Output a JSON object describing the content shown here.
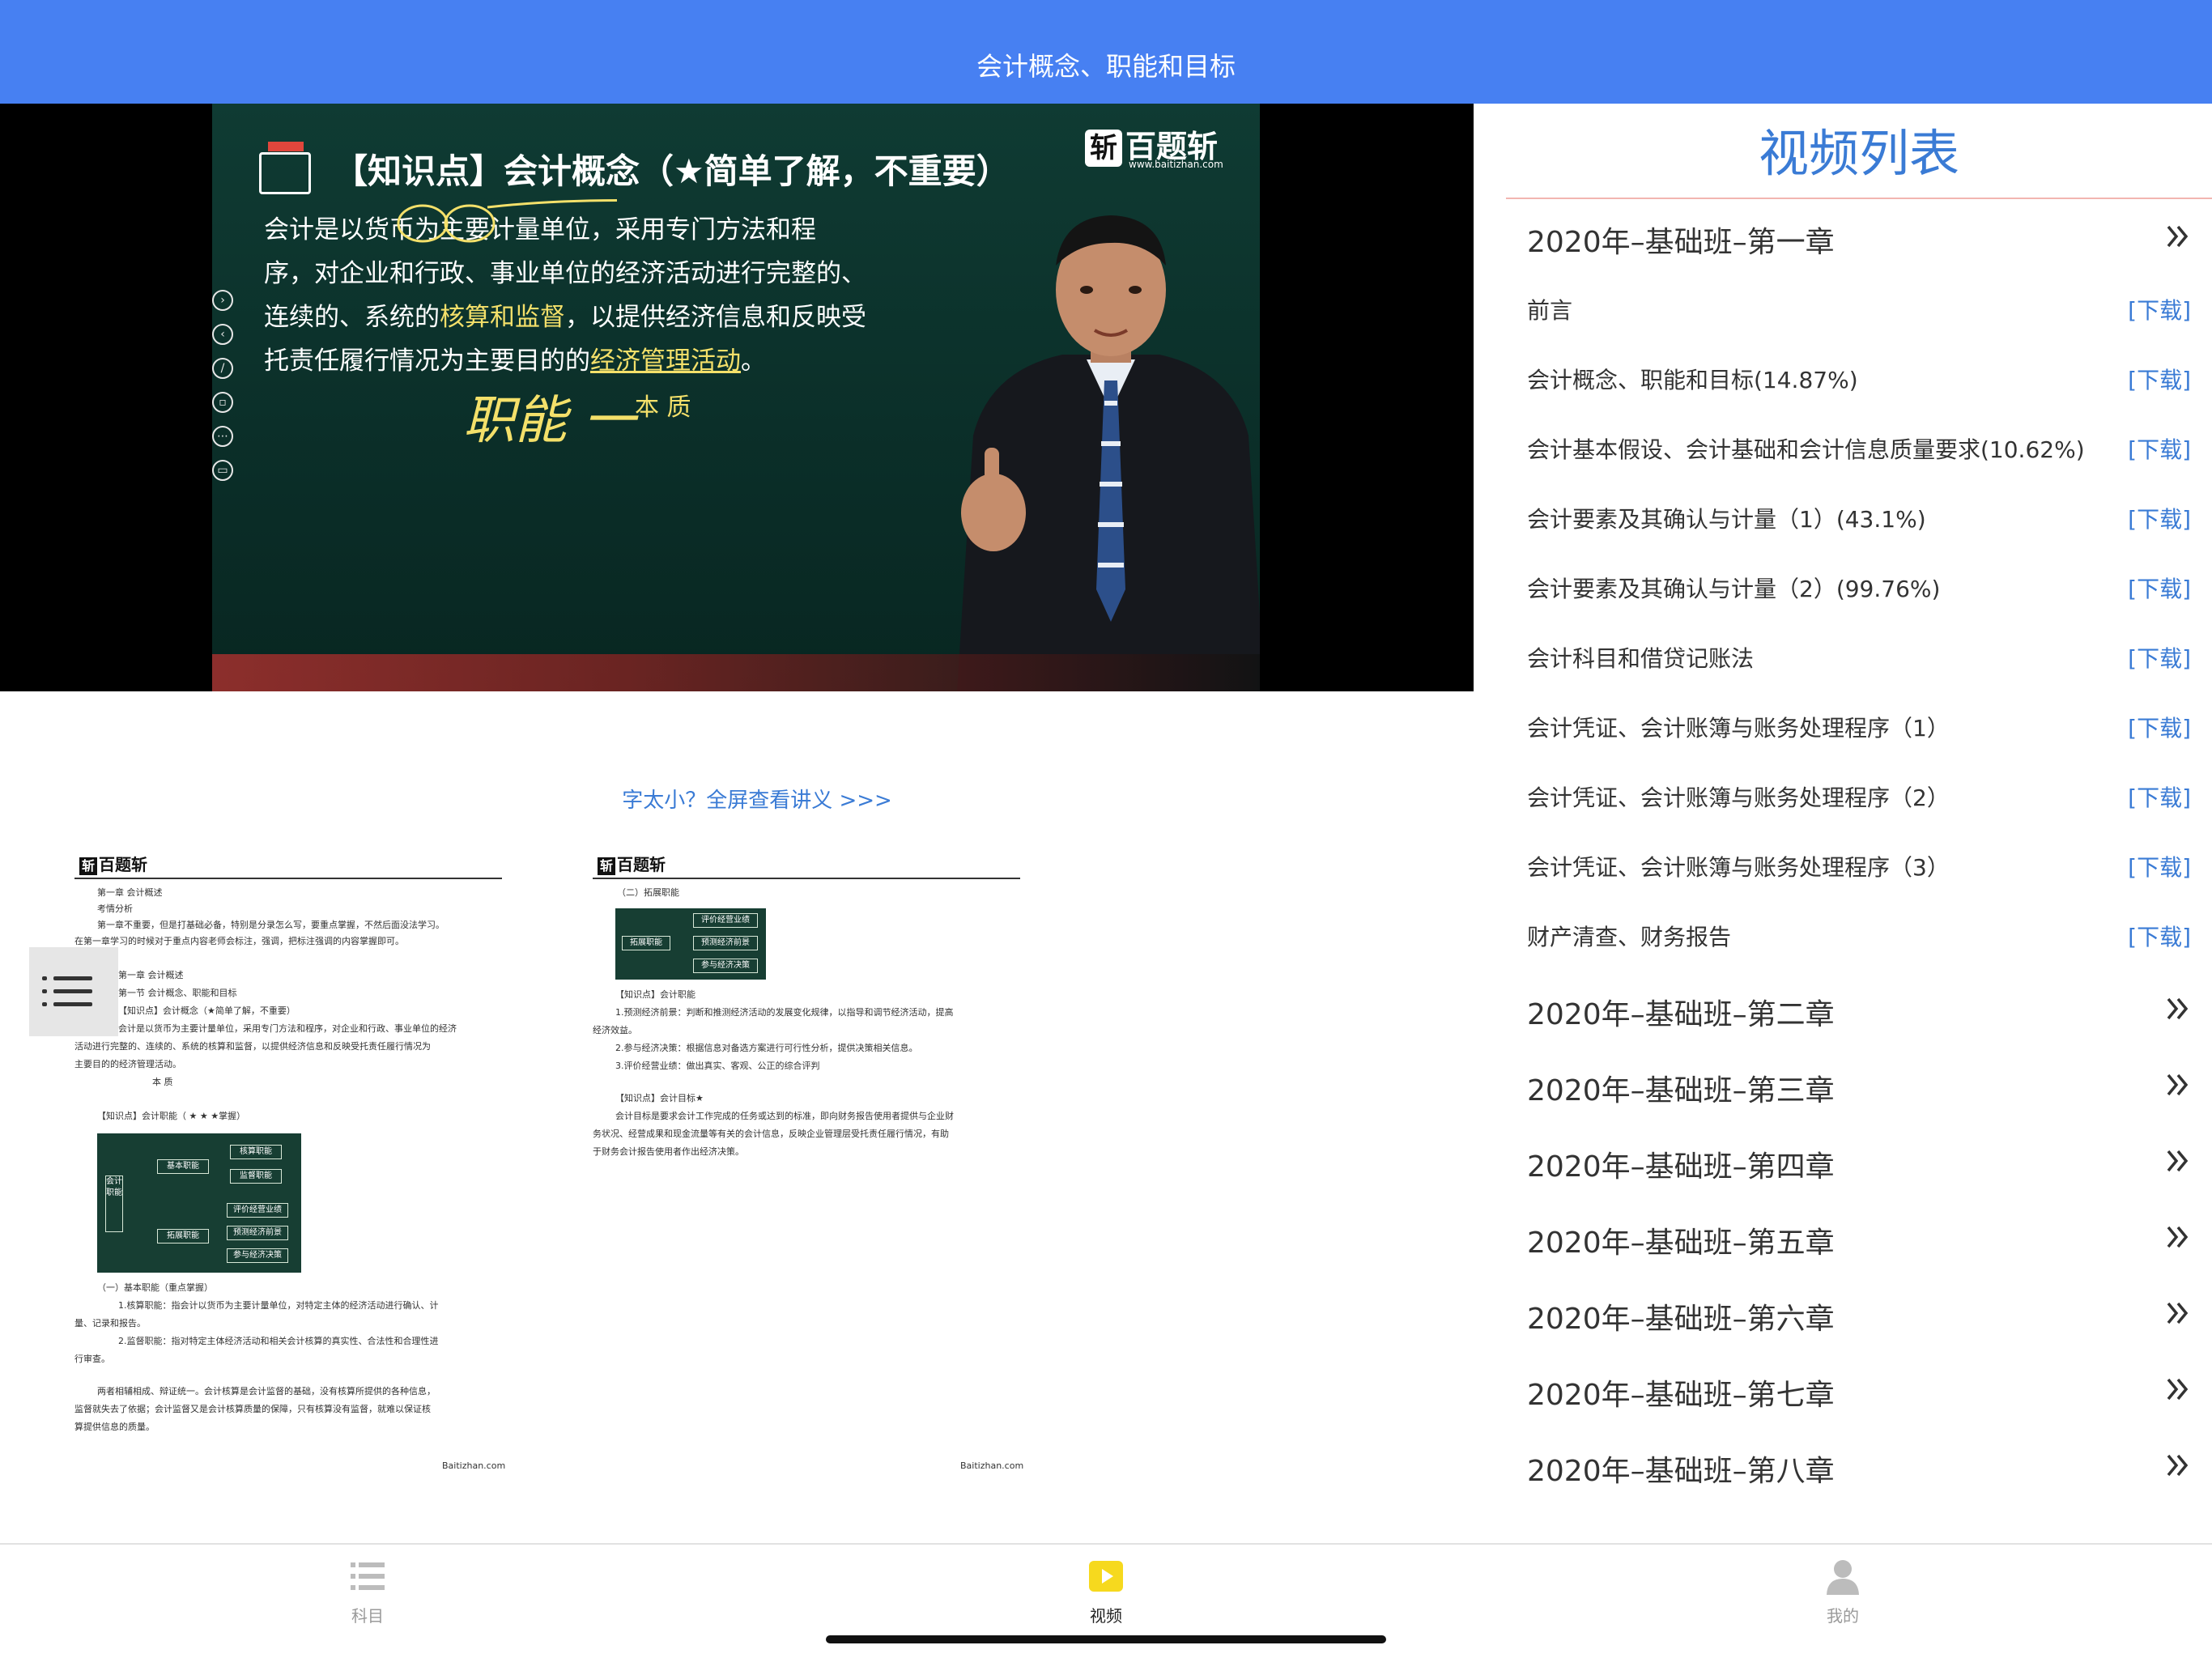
{
  "header": {
    "title": "会计概念、职能和目标"
  },
  "video": {
    "logo_text": "百题斩",
    "logo_mark": "斩",
    "logo_sub": "www.baitizhan.com",
    "heading": "【知识点】会计概念（★简单了解，不重要）",
    "lines": [
      {
        "pre": "会计是以货币为主要计量单位，采用专门方法和程",
        "hl": "",
        "post": ""
      },
      {
        "pre": "序，对企业和行政、事业单位的经济活动进行完整的、",
        "hl": "",
        "post": ""
      },
      {
        "pre": "连续的、系统的",
        "hl": "核算和监督",
        "post": "，以提供经济信息和反映受"
      },
      {
        "pre": "托责任履行情况为主要目的的",
        "hl": "经济管理活动",
        "post": "。"
      }
    ],
    "note": "本 质",
    "scrawl": "职能 一"
  },
  "handout_link": "字太小？全屏查看讲义 >>>",
  "handout": {
    "logo_mark": "斩",
    "logo_text": "百题斩",
    "page1": {
      "lines": [
        "第一章  会计概述",
        "考情分析",
        "第一章不重要，但是打基础必备，特别是分录怎么写，要重点掌握，不然后面没法学习。",
        "在第一章学习的时候对于重点内容老师会标注，强调，把标注强调的内容掌握即可。",
        "第一章  会计概述",
        "第一节  会计概念、职能和目标",
        "【知识点】会计概念（★简单了解，不重要）",
        "会计是以货币为主要计量单位，采用专门方法和程序，对企业和行政、事业单位的经济",
        "活动进行完整的、连续的、系统的核算和监督，以提供经济信息和反映受托责任履行情况为",
        "主要目的的经济管理活动。",
        "本 质",
        "【知识点】会计职能（ ★ ★ ★掌握）",
        "（一）基本职能（重点掌握）",
        "1.核算职能：指会计以货币为主要计量单位，对特定主体的经济活动进行确认、计",
        "量、记录和报告。",
        "2.监督职能：指对特定主体经济活动和相关会计核算的真实性、合法性和合理性进",
        "行审查。",
        "两者相辅相成、辩证统一。会计核算是会计监督的基础，没有核算所提供的各种信息，",
        "监督就失去了依据；会计监督又是会计核算质量的保障，只有核算没有监督，就难以保证核",
        "算提供信息的质量。"
      ],
      "diagram": [
        "会计职能",
        "基本职能",
        "拓展职能",
        "核算职能",
        "监督职能",
        "评价经营业绩",
        "预测经济前景",
        "参与经济决策"
      ],
      "footer": "Baitizhan.com"
    },
    "page2": {
      "lines": [
        "（二）拓展职能",
        "【知识点】会计职能",
        "1.预测经济前景：判断和推测经济活动的发展变化规律，以指导和调节经济活动，提高",
        "经济效益。",
        "2.参与经济决策：根据信息对备选方案进行可行性分析，提供决策相关信息。",
        "3.评价经营业绩：做出真实、客观、公正的综合评判",
        "【知识点】会计目标★",
        "会计目标是要求会计工作完成的任务或达到的标准，即向财务报告使用者提供与企业财",
        "务状况、经营成果和现金流量等有关的会计信息，反映企业管理层受托责任履行情况，有助",
        "于财务会计报告使用者作出经济决策。"
      ],
      "diagram": [
        "拓展职能",
        "评价经营业绩",
        "预测经济前景",
        "参与经济决策"
      ],
      "footer": "Baitizhan.com"
    }
  },
  "panel": {
    "title": "视频列表",
    "chapter1": "2020年–基础班–第一章",
    "lessons": [
      {
        "label": "前言",
        "action": "[下载]"
      },
      {
        "label": "会计概念、职能和目标(14.87%)",
        "action": "[下载]"
      },
      {
        "label": "会计基本假设、会计基础和会计信息质量要求(10.62%)",
        "action": "[下载]"
      },
      {
        "label": "会计要素及其确认与计量（1）(43.1%)",
        "action": "[下载]"
      },
      {
        "label": "会计要素及其确认与计量（2）(99.76%)",
        "action": "[下载]"
      },
      {
        "label": "会计科目和借贷记账法",
        "action": "[下载]"
      },
      {
        "label": "会计凭证、会计账簿与账务处理程序（1）",
        "action": "[下载]"
      },
      {
        "label": "会计凭证、会计账簿与账务处理程序（2）",
        "action": "[下载]"
      },
      {
        "label": "会计凭证、会计账簿与账务处理程序（3）",
        "action": "[下载]"
      },
      {
        "label": "财产清查、财务报告",
        "action": "[下载]"
      }
    ],
    "chapters": [
      "2020年–基础班–第二章",
      "2020年–基础班–第三章",
      "2020年–基础班–第四章",
      "2020年–基础班–第五章",
      "2020年–基础班–第六章",
      "2020年–基础班–第七章",
      "2020年–基础班–第八章"
    ]
  },
  "tabbar": {
    "tabs": [
      {
        "label": "科目",
        "icon": "list-icon"
      },
      {
        "label": "视频",
        "icon": "play-icon"
      },
      {
        "label": "我的",
        "icon": "person-icon"
      }
    ],
    "active": "视频"
  },
  "colors": {
    "header": "#4780f2",
    "accent": "#3a7bd5",
    "active_tab": "#f6d91e"
  }
}
